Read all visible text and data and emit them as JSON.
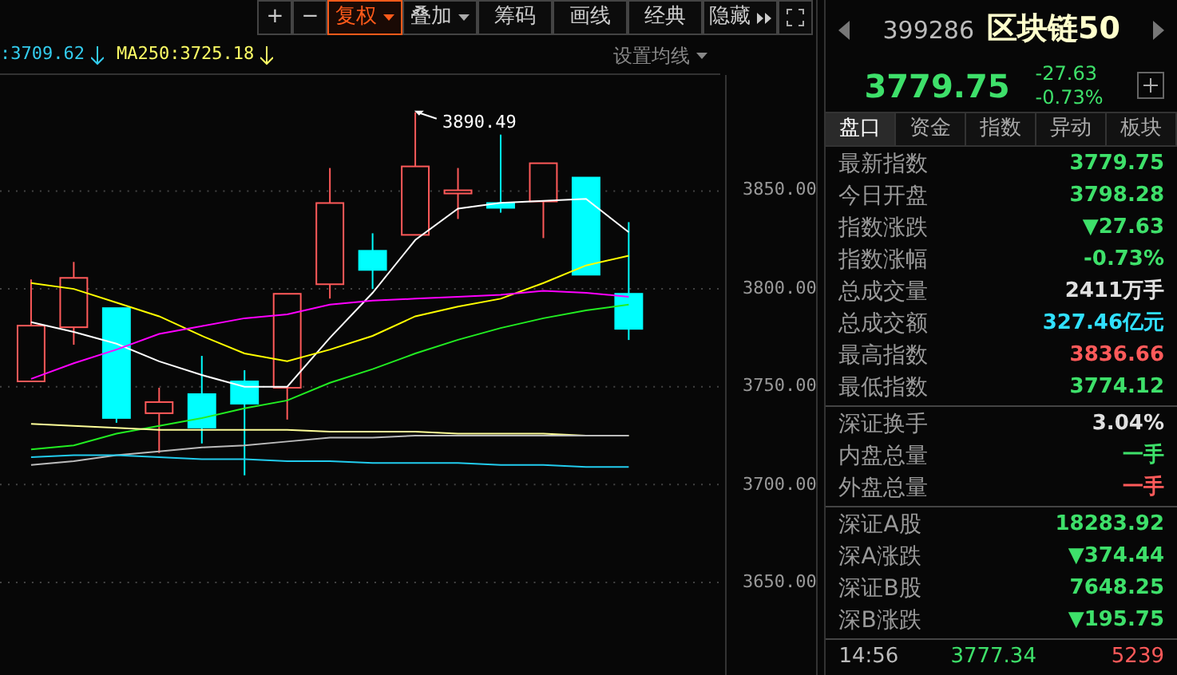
{
  "toolbar": {
    "buttons": [
      {
        "label": "+",
        "kind": "icon",
        "selected": false
      },
      {
        "label": "−",
        "kind": "icon",
        "selected": false
      },
      {
        "label": "复权",
        "kind": "text",
        "selected": true,
        "caret": true
      },
      {
        "label": "叠加",
        "kind": "text",
        "selected": false,
        "caret": true
      },
      {
        "label": "筹码",
        "kind": "text",
        "selected": false
      },
      {
        "label": "画线",
        "kind": "text",
        "selected": false
      },
      {
        "label": "经典",
        "kind": "text",
        "selected": false
      },
      {
        "label": "隐藏",
        "kind": "more",
        "selected": false
      },
      {
        "kind": "fullscreen",
        "selected": false
      }
    ]
  },
  "ma_legend": {
    "items": [
      {
        "text": ":3709.62",
        "color": "#33ccee"
      },
      {
        "text": "MA250:3725.18",
        "color": "#ffff66"
      }
    ],
    "settings": "设置均线"
  },
  "chart": {
    "high_label": "3890.49",
    "chart_data": {
      "type": "line",
      "ylim": [
        3603,
        3909
      ],
      "grid": true,
      "yticks": [
        {
          "value": 3650,
          "label": "3650.00"
        },
        {
          "value": 3700,
          "label": "3700.00"
        },
        {
          "value": 3750,
          "label": "3750.00"
        },
        {
          "value": 3800,
          "label": "3800.00"
        },
        {
          "value": 3850,
          "label": "3850.00"
        }
      ],
      "series": [
        {
          "color": "#ffffff",
          "values": [
            3783,
            3778,
            3772,
            3763,
            3756,
            3750,
            3750,
            3775,
            3798,
            3825,
            3841,
            3844,
            3845,
            3846,
            3829
          ]
        },
        {
          "color": "#ffff00",
          "values": [
            3803,
            3800,
            3793,
            3786,
            3776,
            3767,
            3763,
            3769,
            3776,
            3786,
            3791,
            3795,
            3803,
            3812,
            3817
          ]
        },
        {
          "color": "#ff00ff",
          "values": [
            3754,
            3762,
            3769,
            3777,
            3781,
            3785,
            3787,
            3792,
            3794,
            3795,
            3796,
            3797,
            3799,
            3798,
            3796
          ]
        },
        {
          "color": "#22ee22",
          "values": [
            3718,
            3720,
            3726,
            3730,
            3734,
            3739,
            3743,
            3752,
            3759,
            3767,
            3774,
            3780,
            3785,
            3789,
            3792
          ]
        },
        {
          "color": "#ffff99",
          "values": [
            3731,
            3730,
            3729,
            3728,
            3728,
            3728,
            3728,
            3727,
            3727,
            3727,
            3726,
            3726,
            3726,
            3725,
            3725
          ]
        },
        {
          "color": "#bbbbbb",
          "values": [
            3710,
            3712,
            3715,
            3717,
            3719,
            3720,
            3722,
            3724,
            3724,
            3725,
            3725,
            3725,
            3725,
            3725,
            3725
          ]
        },
        {
          "color": "#22ccee",
          "values": [
            3714,
            3715,
            3715,
            3714,
            3713,
            3713,
            3712,
            3712,
            3711,
            3711,
            3711,
            3710,
            3710,
            3709,
            3709
          ]
        }
      ]
    }
  },
  "quote": {
    "code": "399286",
    "name": "区块链50",
    "price": "3779.75",
    "change": "-27.63",
    "change_pct": "-0.73%"
  },
  "tabs": [
    {
      "label": "盘口",
      "selected": true
    },
    {
      "label": "资金",
      "selected": false
    },
    {
      "label": "指数",
      "selected": false
    },
    {
      "label": "异动",
      "selected": false
    },
    {
      "label": "板块",
      "selected": false
    }
  ],
  "sections": [
    [
      {
        "label": "最新指数",
        "value": "3779.75",
        "color": "#3ee06a"
      },
      {
        "label": "今日开盘",
        "value": "3798.28",
        "color": "#3ee06a"
      },
      {
        "label": "指数涨跌",
        "value": "▼27.63",
        "color": "#3ee06a"
      },
      {
        "label": "指数涨幅",
        "value": "-0.73%",
        "color": "#3ee06a"
      },
      {
        "label": "总成交量",
        "value": "2411万手",
        "color": "#e0e0e0"
      },
      {
        "label": "总成交额",
        "value": "327.46亿元",
        "color": "#30e0ff"
      },
      {
        "label": "最高指数",
        "value": "3836.66",
        "color": "#ff5a5a"
      },
      {
        "label": "最低指数",
        "value": "3774.12",
        "color": "#3ee06a"
      }
    ],
    [
      {
        "label": "深证换手",
        "value": "3.04%",
        "color": "#e0e0e0"
      },
      {
        "label": "内盘总量",
        "value": "一手",
        "color": "#3ee06a"
      },
      {
        "label": "外盘总量",
        "value": "一手",
        "color": "#ff5a5a"
      }
    ],
    [
      {
        "label": "深证A股",
        "value": "18283.92",
        "color": "#3ee06a"
      },
      {
        "label": "深A涨跌",
        "value": "▼374.44",
        "color": "#3ee06a"
      },
      {
        "label": "深证B股",
        "value": "7648.25",
        "color": "#3ee06a"
      },
      {
        "label": "深B涨跌",
        "value": "▼195.75",
        "color": "#3ee06a"
      }
    ]
  ],
  "ticks": [
    {
      "time": "14:56",
      "price": "3777.34",
      "volume": "5239"
    }
  ]
}
